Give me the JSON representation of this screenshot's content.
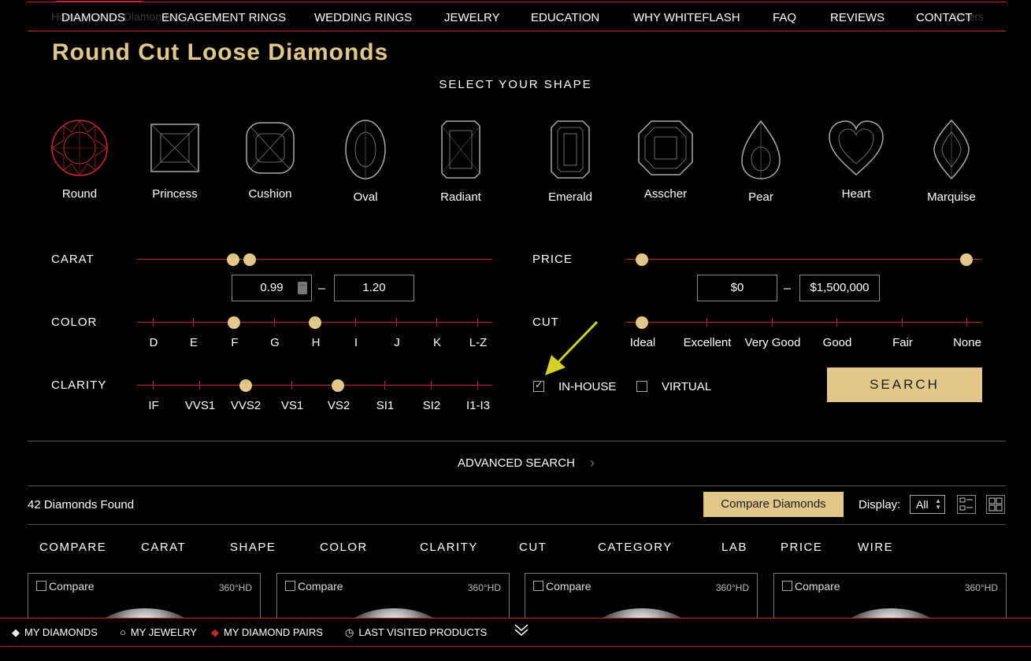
{
  "nav": {
    "ghost_breadcrumb": "Home › Loose Diamonds",
    "ghost_right": "Filters",
    "items": [
      "DIAMONDS",
      "ENGAGEMENT RINGS",
      "WEDDING RINGS",
      "JEWELRY",
      "EDUCATION",
      "WHY WHITEFLASH",
      "FAQ",
      "REVIEWS",
      "CONTACT"
    ],
    "active_color": "#c0282b"
  },
  "page": {
    "title": "Round Cut Loose Diamonds"
  },
  "shapes": {
    "heading": "SELECT YOUR SHAPE",
    "items": [
      "Round",
      "Princess",
      "Cushion",
      "Oval",
      "Radiant",
      "Emerald",
      "Asscher",
      "Pear",
      "Heart",
      "Marquise"
    ],
    "selected": "Round"
  },
  "filters": {
    "carat": {
      "label": "CARAT",
      "min": "0.99",
      "max": "1.20",
      "dash": "–"
    },
    "price": {
      "label": "PRICE",
      "min": "$0",
      "max": "$1,500,000",
      "dash": "–"
    },
    "color": {
      "label": "COLOR",
      "grades": [
        "D",
        "E",
        "F",
        "G",
        "H",
        "I",
        "J",
        "K",
        "L-Z"
      ],
      "from": "F",
      "to": "H"
    },
    "cut": {
      "label": "CUT",
      "grades": [
        "Ideal",
        "Excellent",
        "Very Good",
        "Good",
        "Fair",
        "None"
      ],
      "from": "Ideal",
      "to": "Ideal"
    },
    "clarity": {
      "label": "CLARITY",
      "grades": [
        "IF",
        "VVS1",
        "VVS2",
        "VS1",
        "VS2",
        "SI1",
        "SI2",
        "I1-I3"
      ],
      "from": "VVS2",
      "to": "VS2"
    },
    "in_house": {
      "label": "IN-HOUSE",
      "checked": true
    },
    "virtual": {
      "label": "VIRTUAL",
      "checked": false
    },
    "search_label": "SEARCH"
  },
  "advanced": {
    "label": "ADVANCED SEARCH",
    "chevron": "›"
  },
  "results": {
    "count_text": "42 Diamonds Found",
    "compare_label": "Compare Diamonds",
    "display_label": "Display:",
    "display_value": "All",
    "columns": [
      "COMPARE",
      "CARAT",
      "SHAPE",
      "COLOR",
      "CLARITY",
      "CUT",
      "CATEGORY",
      "LAB",
      "PRICE",
      "WIRE"
    ],
    "cards": [
      {
        "compare": "Compare",
        "badge": "360°HD"
      },
      {
        "compare": "Compare",
        "badge": "360°HD"
      },
      {
        "compare": "Compare",
        "badge": "360°HD"
      },
      {
        "compare": "Compare",
        "badge": "360°HD"
      }
    ]
  },
  "bottom_bar": {
    "items": [
      {
        "label": "MY DIAMONDS",
        "icon": "diamond-icon"
      },
      {
        "label": "MY JEWELRY",
        "icon": "ring-icon"
      },
      {
        "label": "MY DIAMOND PAIRS",
        "icon": "diamond-pair-icon"
      },
      {
        "label": "LAST VISITED PRODUCTS",
        "icon": "clock-icon"
      }
    ]
  },
  "colors": {
    "gold": "#e1c789",
    "red": "#c0282b",
    "annotation_arrow": "#d4d22a"
  }
}
